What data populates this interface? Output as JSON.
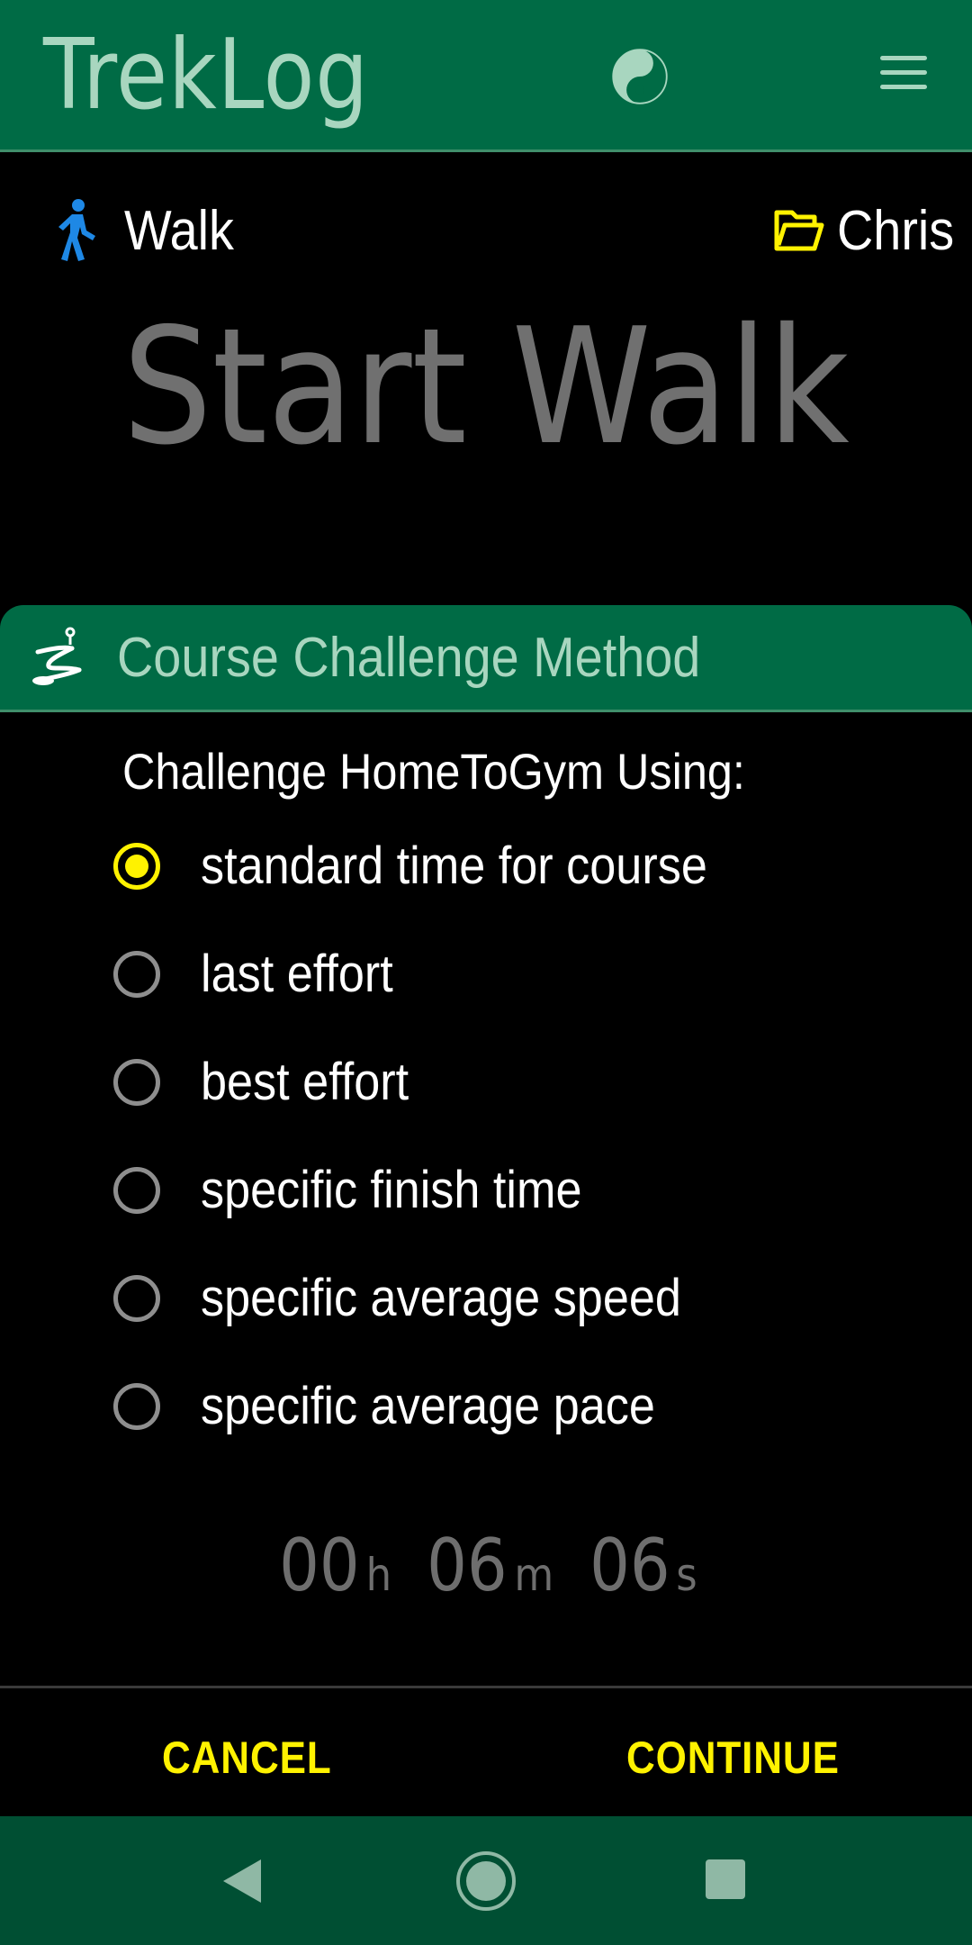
{
  "app_bar": {
    "title": "TrekLog",
    "theme_icon": "yin-yang-icon",
    "menu_icon": "hamburger-menu-icon"
  },
  "activity": {
    "type_icon": "walking-person-icon",
    "type_label": "Walk",
    "group_icon": "folder-open-icon",
    "user_label": "Chris",
    "start_title": "Start Walk"
  },
  "dialog": {
    "header_icon": "course-path-icon",
    "title": "Course Challenge Method",
    "prompt": "Challenge HomeToGym Using:",
    "options": [
      {
        "label": "standard time for course",
        "selected": true
      },
      {
        "label": "last effort",
        "selected": false
      },
      {
        "label": "best effort",
        "selected": false
      },
      {
        "label": "specific finish time",
        "selected": false
      },
      {
        "label": "specific average speed",
        "selected": false
      },
      {
        "label": "specific average pace",
        "selected": false
      }
    ],
    "time": {
      "hours": "00",
      "hours_unit": "h",
      "minutes": "06",
      "minutes_unit": "m",
      "seconds": "06",
      "seconds_unit": "s"
    },
    "cancel_label": "CANCEL",
    "continue_label": "CONTINUE"
  },
  "colors": {
    "primary_green": "#006B45",
    "accent_yellow": "#FFF200",
    "header_text": "#A8D6BF",
    "walker_blue": "#1E88E5",
    "nav_bar": "#004F33"
  },
  "nav": {
    "back_icon": "back-triangle-icon",
    "home_icon": "home-circle-icon",
    "recent_icon": "recent-apps-square-icon"
  }
}
